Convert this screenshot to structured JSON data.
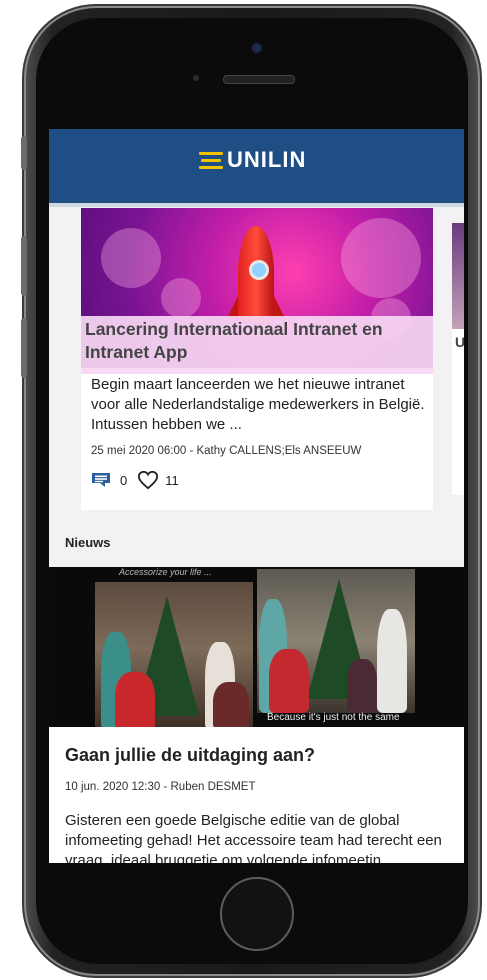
{
  "app": {
    "brand": "UNILIN"
  },
  "featured": [
    {
      "title": "Lancering Internationaal Intranet en Intranet App",
      "excerpt": "Begin maart lanceerden we het nieuwe intranet voor alle Nederlandstalige medewerkers in België. Intussen hebben we ...",
      "meta": "25 mei 2020 06:00 - Kathy CALLENS;Els ANSEEUW",
      "comments": "0",
      "likes": "11"
    }
  ],
  "peek_card": {
    "title_fragment": "U"
  },
  "news_section": {
    "title": "Nieuws",
    "image_caption_top": "Accessorize your life ...",
    "image_caption_bottom": "Because it's just not the same",
    "item": {
      "title": "Gaan jullie de uitdaging aan?",
      "meta": "10 jun. 2020 12:30 - Ruben DESMET",
      "excerpt": "Gisteren een goede Belgische editie van de global infomeeting gehad! Het accessoire team had terecht een vraag, ideaal bruggetje om volgende infomeetin..."
    }
  },
  "icons": {
    "comment": "comment-icon",
    "like": "heart-icon"
  },
  "colors": {
    "header": "#1f4e84",
    "accent_icon": "#2b5f9e"
  }
}
